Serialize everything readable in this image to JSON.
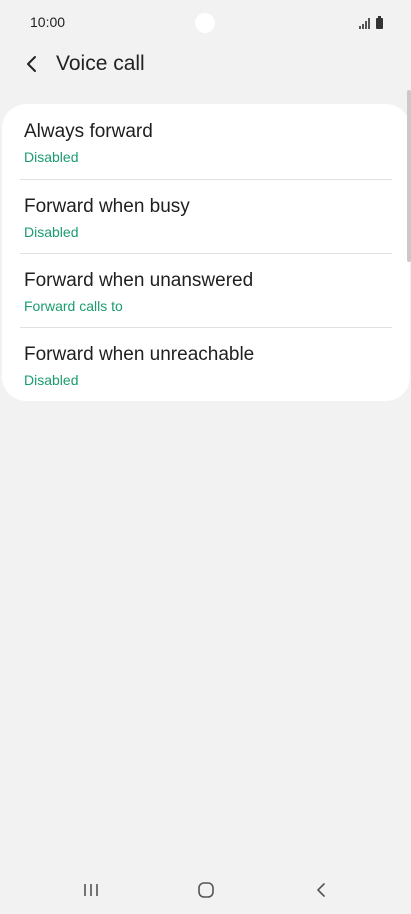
{
  "status_bar": {
    "time": "10:00"
  },
  "header": {
    "title": "Voice call",
    "back_icon": "chevron-left-icon"
  },
  "items": [
    {
      "title": "Always forward",
      "subtitle": "Disabled"
    },
    {
      "title": "Forward when busy",
      "subtitle": "Disabled"
    },
    {
      "title": "Forward when unanswered",
      "subtitle": "Forward calls to"
    },
    {
      "title": "Forward when unreachable",
      "subtitle": "Disabled"
    }
  ],
  "colors": {
    "background": "#f2f2f2",
    "card": "#ffffff",
    "accent": "#1a9c6d",
    "text": "#1f1f1f"
  },
  "nav": {
    "recents_icon": "recents-icon",
    "home_icon": "home-icon",
    "back_icon": "back-icon"
  }
}
